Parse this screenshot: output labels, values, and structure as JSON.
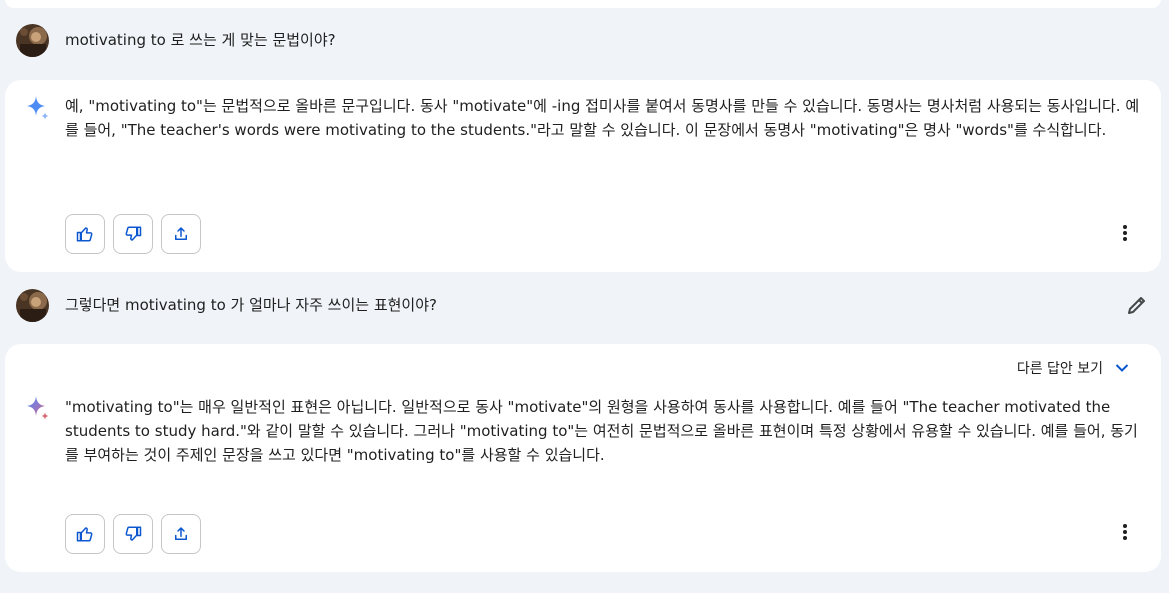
{
  "conversation": [
    {
      "role": "user",
      "text": "motivating to 로 쓰는 게 맞는 문법이야?"
    },
    {
      "role": "model",
      "text": "예, \"motivating to\"는 문법적으로 올바른 문구입니다. 동사 \"motivate\"에 -ing 접미사를 붙여서 동명사를 만들 수 있습니다. 동명사는 명사처럼 사용되는 동사입니다. 예를 들어, \"The teacher's words were motivating to the students.\"라고 말할 수 있습니다. 이 문장에서 동명사 \"motivating\"은 명사 \"words\"를 수식합니다."
    },
    {
      "role": "user",
      "text": "그렇다면 motivating to 가 얼마나 자주 쓰이는 표현이야?"
    },
    {
      "role": "model",
      "drafts_label": "다른 답안 보기",
      "text": "\"motivating to\"는 매우 일반적인 표현은 아닙니다. 일반적으로 동사 \"motivate\"의 원형을 사용하여 동사를 사용합니다. 예를 들어 \"The teacher motivated the students to study hard.\"와 같이 말할 수 있습니다. 그러나 \"motivating to\"는 여전히 문법적으로 올바른 표현이며 특정 상황에서 유용할 수 있습니다. 예를 들어, 동기를 부여하는 것이 주제인 문장을 쓰고 있다면 \"motivating to\"를 사용할 수 있습니다."
    }
  ],
  "icons": {
    "user_avatar": "avatar-photo",
    "model_avatar_first": "sparkle-icon-blue",
    "model_avatar_second": "sparkle-icon-gradient",
    "like": "thumbs-up-icon",
    "dislike": "thumbs-down-icon",
    "share": "share-icon",
    "more": "more-vert-icon",
    "edit": "pencil-icon",
    "drafts_toggle": "chevron-down-icon"
  },
  "colors": {
    "background": "#f0f4f9",
    "card": "#ffffff",
    "accent_blue": "#0b57d0",
    "sparkle_blue": "#4e8cf5",
    "sparkle_red": "#d96570"
  }
}
